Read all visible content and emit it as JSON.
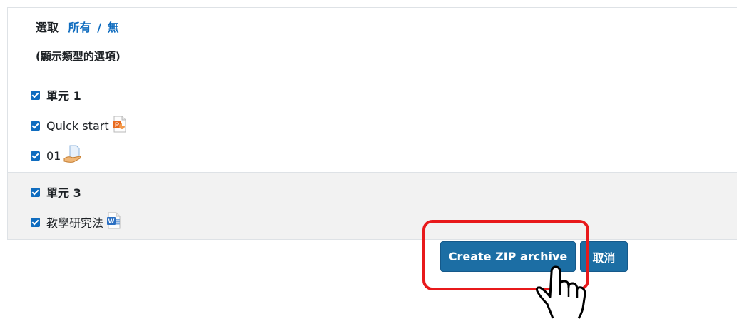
{
  "select": {
    "label": "選取",
    "all": "所有",
    "separator": "/",
    "none": "無"
  },
  "show_types": "(顯示類型的選項)",
  "sections": [
    {
      "title": "單元 1",
      "items": [
        {
          "name": "Quick start",
          "icon": "powerpoint-file-icon"
        },
        {
          "name": "01",
          "icon": "hand-document-icon"
        }
      ]
    },
    {
      "title": "單元 3",
      "items": [
        {
          "name": "教學研究法",
          "icon": "word-file-icon"
        }
      ]
    }
  ],
  "buttons": {
    "create_zip": "Create ZIP archive",
    "cancel": "取消"
  },
  "colors": {
    "primary": "#0f6cbf",
    "button": "#1c6ea4",
    "highlight": "#e8191b"
  }
}
